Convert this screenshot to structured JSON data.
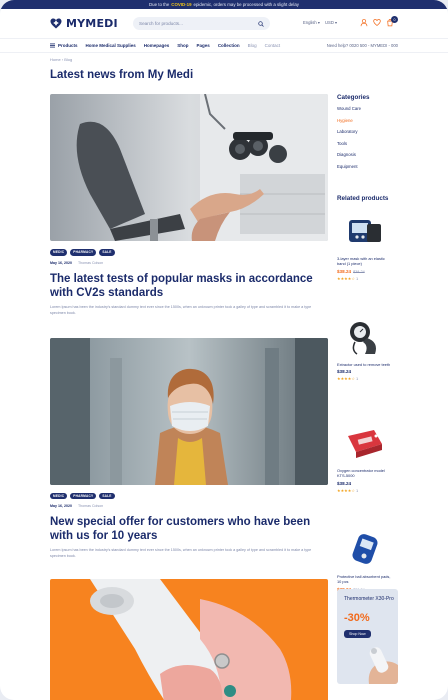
{
  "announcement": {
    "prefix": "Due to the",
    "highlight": "COVID-19",
    "suffix": "epidemic, orders may be processed with a slight delay"
  },
  "header": {
    "logo_text": "MYMEDI",
    "search_placeholder": "Search for products...",
    "language": "English",
    "currency": "USD",
    "cart_count": "0"
  },
  "nav": {
    "products": "Products",
    "items": [
      "Home Medical Supplies",
      "Homepages",
      "Shop",
      "Pages",
      "Collection",
      "Blog",
      "Contact"
    ],
    "help": "Need help? 0020 500 - MYMEDI - 000"
  },
  "breadcrumb": {
    "home": "Home",
    "current": "Blog"
  },
  "page_title": "Latest news from My Medi",
  "posts": [
    {
      "tags": [
        "MEDIC",
        "PHARMACY",
        "SALE"
      ],
      "date": "May 16, 2020",
      "author": "Thomas Colson",
      "title": "The latest tests of popular masks in accordance with CV2s standards",
      "excerpt": "Lorem Ipsum has been the industry's standard dummy text ever since the 1500s, when an unknown printer took a galley of type and scrambled it to make a type specimen book."
    },
    {
      "tags": [
        "MEDIC",
        "PHARMACY",
        "SALE"
      ],
      "date": "May 16, 2020",
      "author": "Thomas Colson",
      "title": "New special offer for customers who have been with us for 10 years",
      "excerpt": "Lorem Ipsum has been the industry's standard dummy text ever since the 1500s, when an unknown printer took a galley of type and scrambled it to make a type specimen book."
    }
  ],
  "sidebar": {
    "categories_title": "Categories",
    "categories": [
      "Wound Care",
      "Hygiene",
      "Laboratory",
      "Tools",
      "Diagnosis",
      "Equipment"
    ],
    "active_category": "Hygiene",
    "related_title": "Related products",
    "products": [
      {
        "name": "3-layer mask with an elastic band (1 piece)",
        "price": "$38.24",
        "old_price": "$38.24",
        "on_sale": true,
        "stars": "★★★★☆",
        "reviews": "1"
      },
      {
        "name": "Extractor used to remove teeth",
        "price": "$38.24",
        "old_price": "",
        "on_sale": false,
        "stars": "★★★★☆",
        "reviews": "1"
      },
      {
        "name": "Oxygen concentrator model KTS-5000",
        "price": "$38.24",
        "old_price": "",
        "on_sale": false,
        "stars": "★★★★☆",
        "reviews": "1"
      },
      {
        "name": "Protective ball absorbent pads, 10 pcs",
        "price": "$38.24",
        "old_price": "$38.24",
        "on_sale": true,
        "stars": "★★★★☆",
        "reviews": "1"
      }
    ],
    "promo": {
      "name": "Thermometer X30-Pro",
      "discount": "-30%",
      "button": "Shop Now"
    }
  }
}
